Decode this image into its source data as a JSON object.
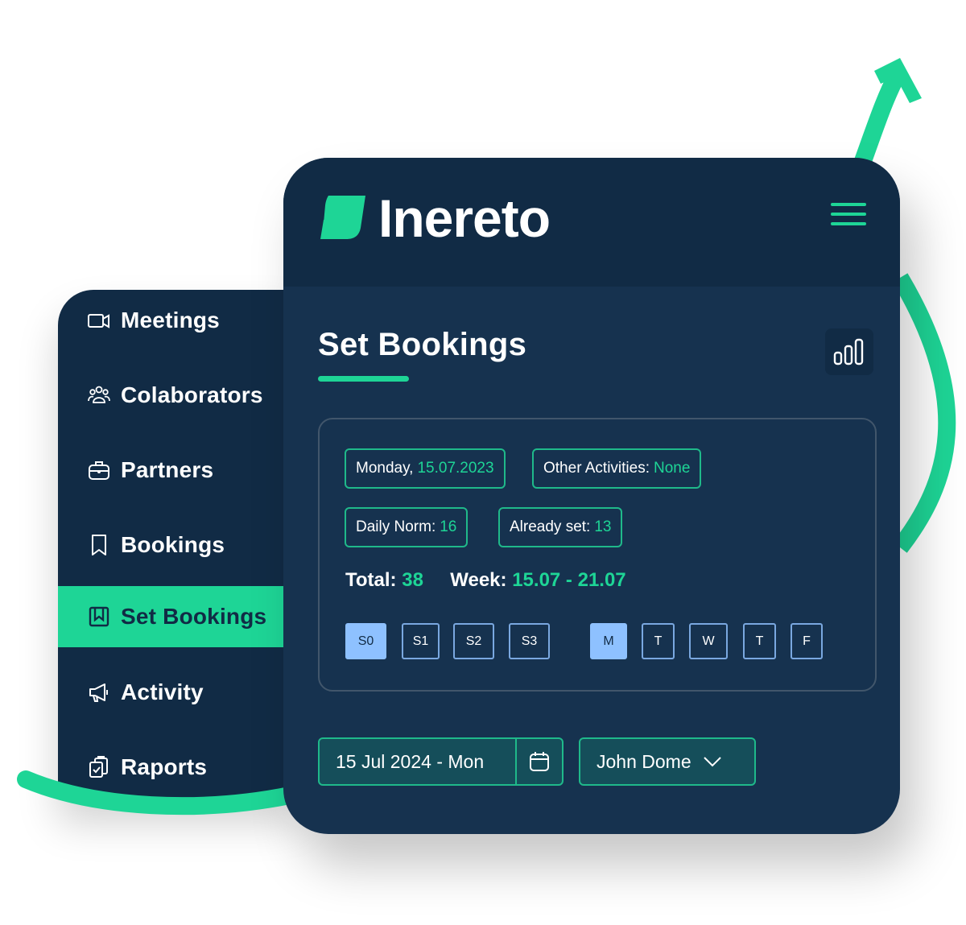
{
  "brand": {
    "name": "Inereto",
    "accent": "#1ed596",
    "navy": "#112b45",
    "panel": "#16324f"
  },
  "sidebar": {
    "items": [
      {
        "label": "Meetings",
        "icon": "video-camera-icon",
        "active": false
      },
      {
        "label": "Colaborators",
        "icon": "users-group-icon",
        "active": false
      },
      {
        "label": "Partners",
        "icon": "briefcase-icon",
        "active": false
      },
      {
        "label": "Bookings",
        "icon": "bookmark-icon",
        "active": false
      },
      {
        "label": "Set Bookings",
        "icon": "bookmark-square-icon",
        "active": true
      },
      {
        "label": "Activity",
        "icon": "megaphone-icon",
        "active": false
      },
      {
        "label": "Raports",
        "icon": "clipboard-check-icon",
        "active": false
      }
    ]
  },
  "header": {
    "menu_icon": "hamburger-menu-icon"
  },
  "main": {
    "title": "Set Bookings",
    "stats_icon": "bar-chart-icon",
    "chips": {
      "date": {
        "label": "Monday,",
        "value": "15.07.2023"
      },
      "other": {
        "label": "Other Activities:",
        "value": "None"
      },
      "norm": {
        "label": "Daily Norm:",
        "value": "16"
      },
      "set": {
        "label": "Already set:",
        "value": "13"
      }
    },
    "totals": {
      "total_label": "Total:",
      "total_value": "38",
      "week_label": "Week:",
      "week_value": "15.07 - 21.07"
    },
    "slots": [
      {
        "label": "S0",
        "selected": true
      },
      {
        "label": "S1",
        "selected": false
      },
      {
        "label": "S2",
        "selected": false
      },
      {
        "label": "S3",
        "selected": false
      }
    ],
    "days": [
      {
        "label": "M",
        "selected": true
      },
      {
        "label": "T",
        "selected": false
      },
      {
        "label": "W",
        "selected": false
      },
      {
        "label": "T",
        "selected": false
      },
      {
        "label": "F",
        "selected": false
      }
    ],
    "date_picker": {
      "value": "15 Jul 2024 - Mon",
      "icon": "calendar-icon"
    },
    "user_select": {
      "value": "John Dome",
      "icon": "chevron-down-icon"
    }
  }
}
